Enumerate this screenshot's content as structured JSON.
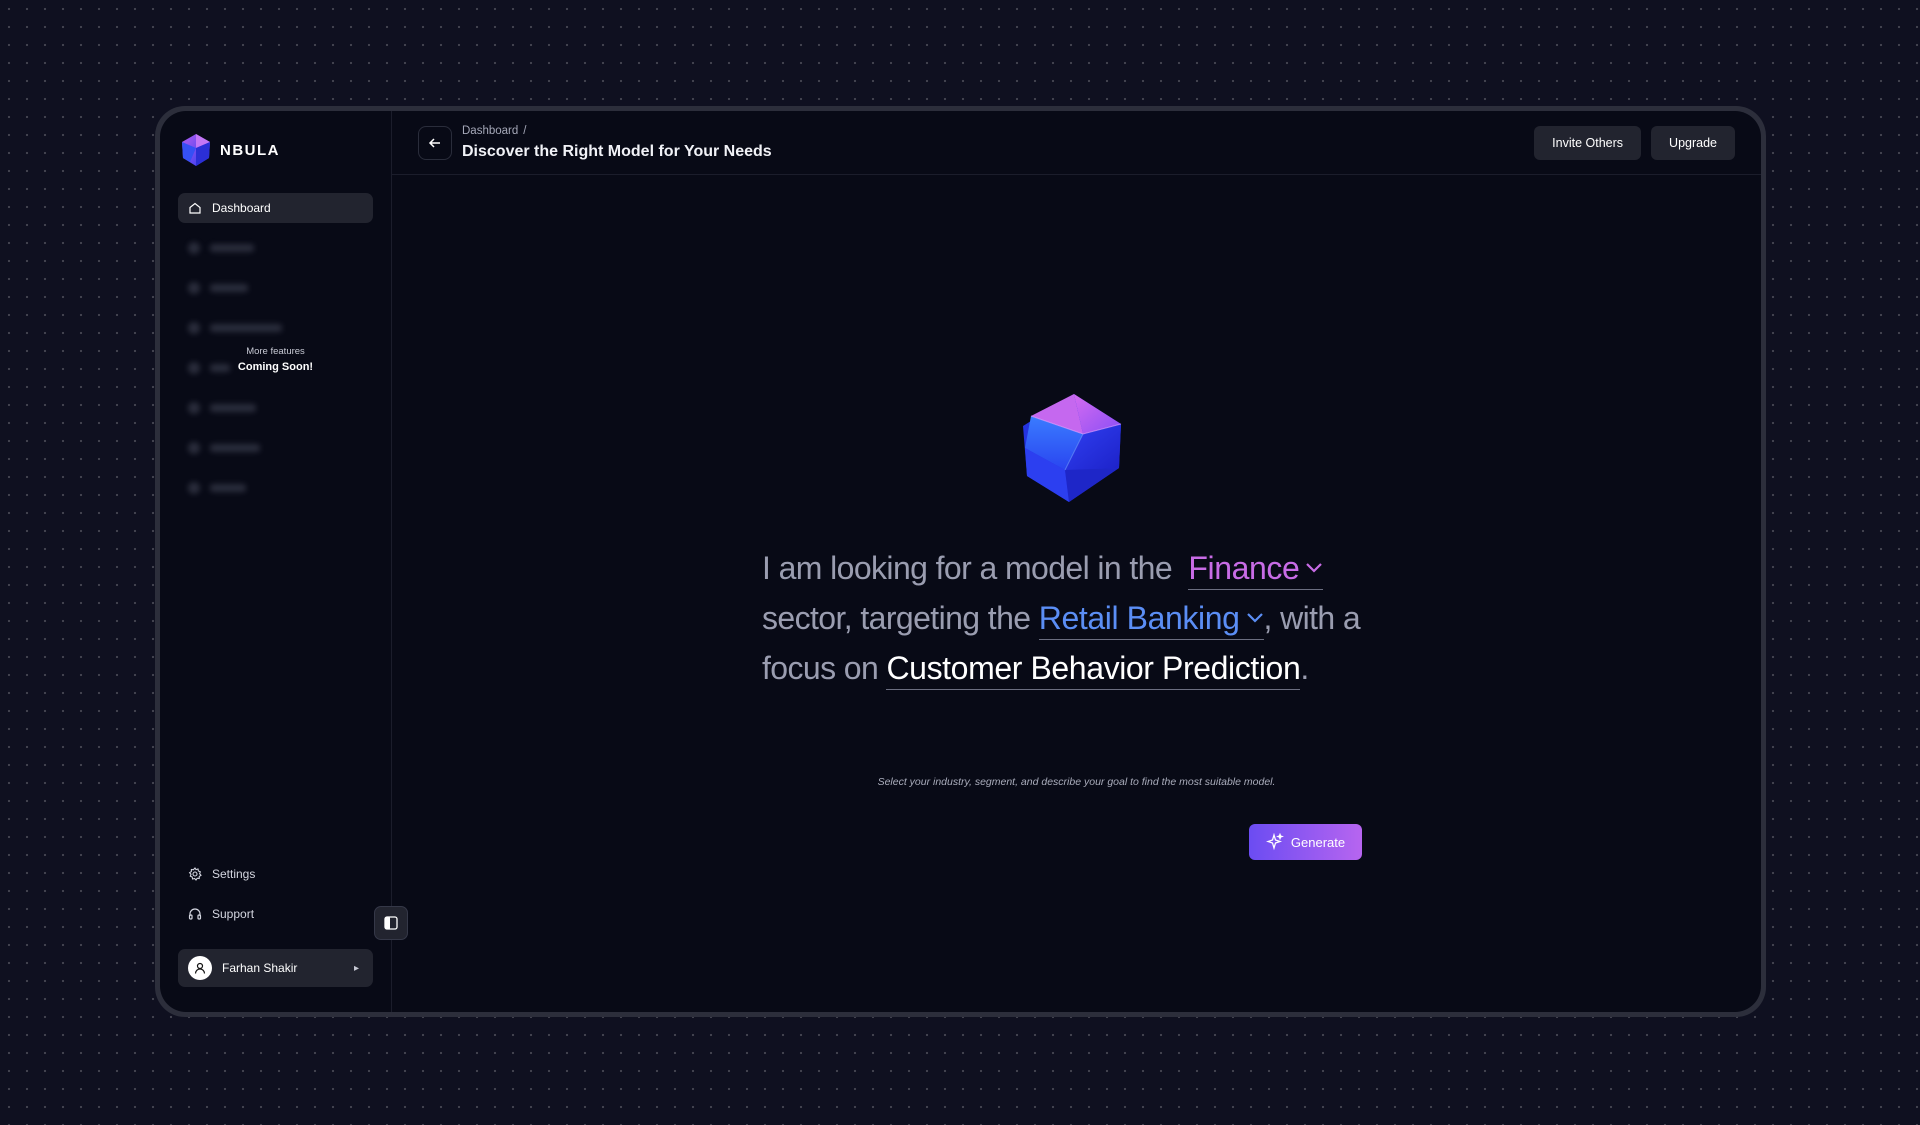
{
  "app": {
    "name": "NBULA"
  },
  "sidebar": {
    "items": [
      {
        "label": "Dashboard",
        "icon": "home-icon",
        "active": true
      }
    ],
    "coming_soon": {
      "small": "More features",
      "big": "Coming Soon!"
    },
    "bottom": [
      {
        "label": "Settings",
        "icon": "gear-icon"
      },
      {
        "label": "Support",
        "icon": "headset-icon"
      }
    ],
    "user": {
      "name": "Farhan Shakir"
    }
  },
  "header": {
    "breadcrumb": "Dashboard",
    "breadcrumb_sep": "/",
    "title": "Discover the Right Model for Your Needs",
    "invite_label": "Invite Others",
    "upgrade_label": "Upgrade"
  },
  "prompt": {
    "part1": "I am looking for a model in the",
    "industry": "Finance",
    "part2": "sector, targeting the",
    "segment": "Retail Banking",
    "part3": ", with a",
    "part4": "focus on",
    "goal": "Customer Behavior Prediction",
    "part5": ".",
    "hint": "Select your industry, segment, and describe your goal to find the most suitable model.",
    "generate_label": "Generate"
  },
  "colors": {
    "industry": "#c86ce6",
    "segment": "#5b8ef5",
    "accent_start": "#6b4cf2",
    "accent_end": "#b765f0"
  }
}
